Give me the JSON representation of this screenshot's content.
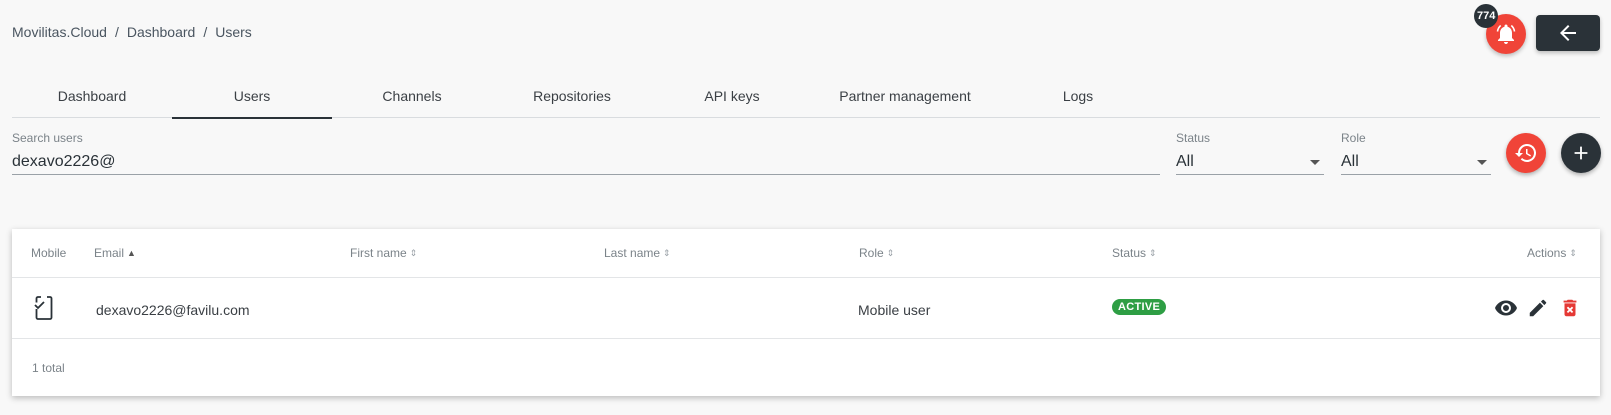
{
  "breadcrumb": [
    "Movilitas.Cloud",
    "Dashboard",
    "Users"
  ],
  "notifications": {
    "count": "774",
    "icon": "bell-icon"
  },
  "back_button": {
    "icon": "arrow-left-icon"
  },
  "tabs": [
    {
      "label": "Dashboard"
    },
    {
      "label": "Users"
    },
    {
      "label": "Channels"
    },
    {
      "label": "Repositories"
    },
    {
      "label": "API keys"
    },
    {
      "label": "Partner management"
    },
    {
      "label": "Logs"
    }
  ],
  "active_tab": "Users",
  "filters": {
    "search": {
      "label": "Search users",
      "value": "dexavo2226@"
    },
    "status": {
      "label": "Status",
      "value": "All"
    },
    "role": {
      "label": "Role",
      "value": "All"
    }
  },
  "table": {
    "columns": {
      "mobile": "Mobile",
      "email": "Email",
      "first_name": "First name",
      "last_name": "Last name",
      "role": "Role",
      "status": "Status",
      "actions": "Actions"
    },
    "rows": [
      {
        "mobile_icon": "mobile-check-icon",
        "email": "dexavo2226@favilu.com",
        "first_name": "",
        "last_name": "",
        "role": "Mobile user",
        "status": "ACTIVE"
      }
    ],
    "total": "1 total"
  },
  "colors": {
    "accent_red": "#f04438",
    "dark": "#2a3238",
    "status_active": "#2e9e44",
    "delete_red": "#e53935"
  }
}
